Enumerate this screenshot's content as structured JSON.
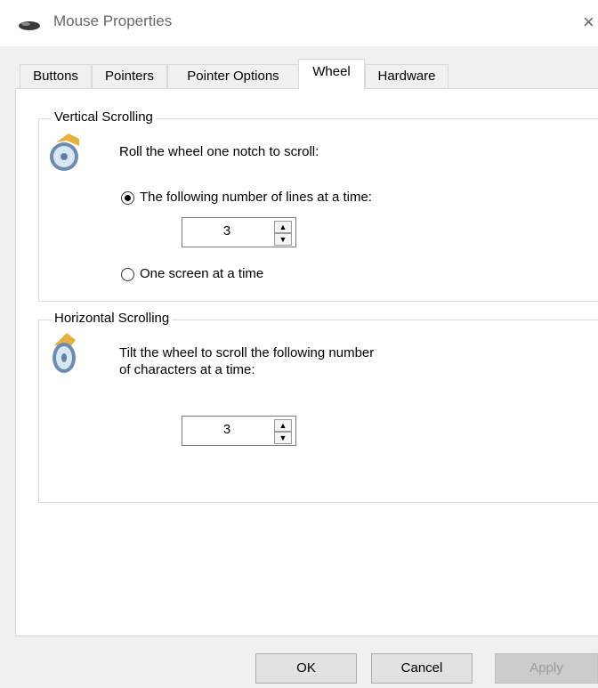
{
  "window": {
    "title": "Mouse Properties",
    "close_glyph": "×"
  },
  "tabs": [
    {
      "label": "Buttons",
      "active": false
    },
    {
      "label": "Pointers",
      "active": false
    },
    {
      "label": "Pointer Options",
      "active": false
    },
    {
      "label": "Wheel",
      "active": true
    },
    {
      "label": "Hardware",
      "active": false
    }
  ],
  "vertical": {
    "legend": "Vertical Scrolling",
    "instruction": "Roll the wheel one notch to scroll:",
    "option_lines": "The following number of lines at a time:",
    "lines_value": "3",
    "option_screen": "One screen at a time",
    "selected": "lines"
  },
  "horizontal": {
    "legend": "Horizontal Scrolling",
    "instruction_line1": "Tilt the wheel to scroll the following number",
    "instruction_line2": "of characters at a time:",
    "chars_value": "3"
  },
  "buttons": {
    "ok": "OK",
    "cancel": "Cancel",
    "apply": "Apply"
  },
  "icons": {
    "app": "mouse-icon",
    "wheel": "mouse-wheel-icon",
    "spin_up": "▲",
    "spin_down": "▼"
  }
}
